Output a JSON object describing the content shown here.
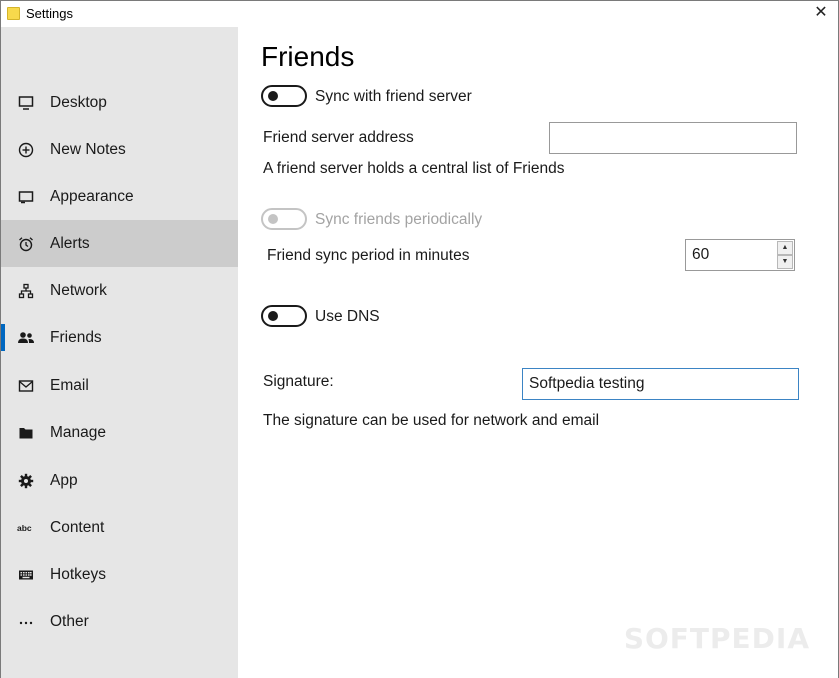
{
  "window": {
    "title": "Settings",
    "close_glyph": "✕"
  },
  "sidebar": {
    "items": [
      {
        "label": "Desktop",
        "icon": "monitor-icon"
      },
      {
        "label": "New Notes",
        "icon": "add-circle-icon"
      },
      {
        "label": "Appearance",
        "icon": "window-icon"
      },
      {
        "label": "Alerts",
        "icon": "alarm-clock-icon"
      },
      {
        "label": "Network",
        "icon": "network-icon"
      },
      {
        "label": "Friends",
        "icon": "people-icon"
      },
      {
        "label": "Email",
        "icon": "mail-icon"
      },
      {
        "label": "Manage",
        "icon": "folder-icon"
      },
      {
        "label": "App",
        "icon": "gear-icon"
      },
      {
        "label": "Content",
        "icon": "abc-icon"
      },
      {
        "label": "Hotkeys",
        "icon": "keyboard-icon"
      },
      {
        "label": "Other",
        "icon": "more-icon"
      }
    ],
    "hovered": "Alerts",
    "selected": "Friends",
    "accent_color": "#0067c0"
  },
  "main": {
    "title": "Friends",
    "sync_server": {
      "label": "Sync with friend server",
      "on": false
    },
    "server_address": {
      "label": "Friend server address",
      "value": ""
    },
    "server_help": "A friend server holds a central list of Friends",
    "sync_periodically": {
      "label": "Sync friends periodically",
      "on": false,
      "enabled": false
    },
    "sync_period": {
      "label": "Friend sync period in minutes",
      "value": "60"
    },
    "use_dns": {
      "label": "Use DNS",
      "on": false
    },
    "signature": {
      "label": "Signature:",
      "value": "Softpedia testing"
    },
    "signature_help": "The signature can be used for network and email"
  },
  "watermark": "SOFTPEDIA"
}
